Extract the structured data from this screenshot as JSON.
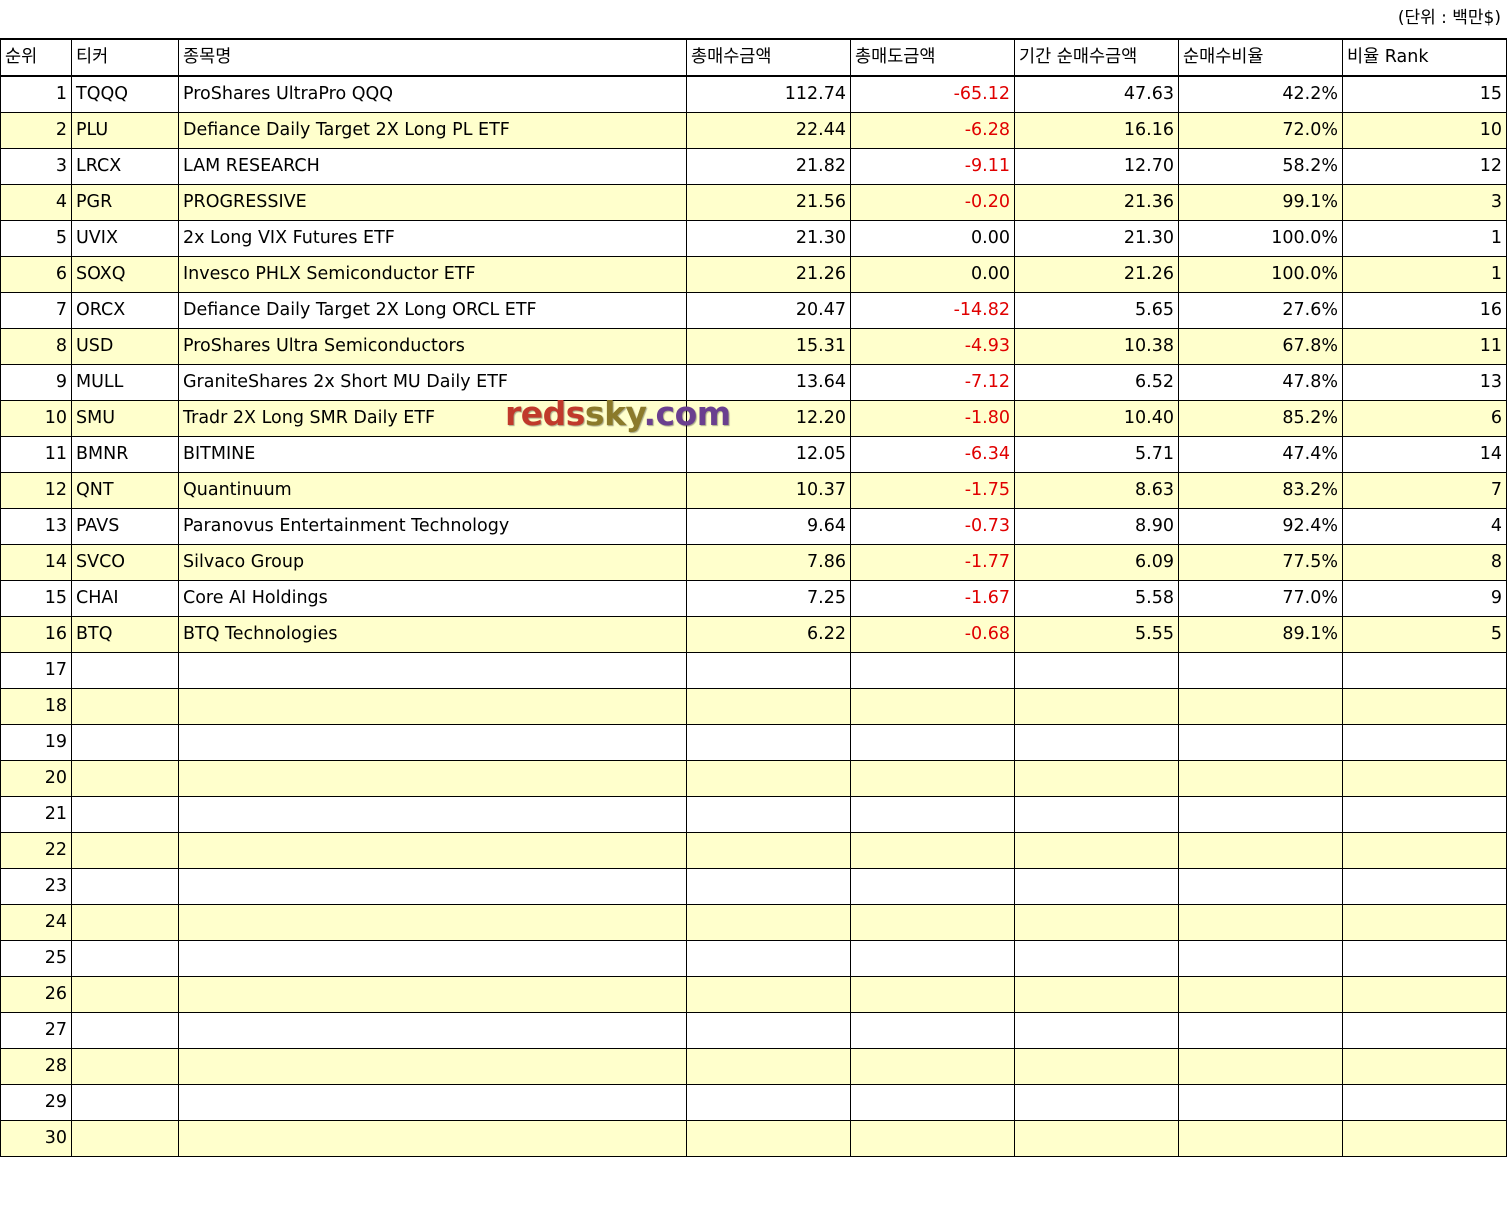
{
  "unit_note": "(단위 : 백만$)",
  "headers": [
    "순위",
    "티커",
    "종목명",
    "총매수금액",
    "총매도금액",
    "기간 순매수금액",
    "순매수비율",
    "비율 Rank"
  ],
  "rows": [
    {
      "rank": "1",
      "ticker": "TQQQ",
      "name": "ProShares UltraPro QQQ",
      "buy": "112.74",
      "sell": "-65.12",
      "net": "47.63",
      "ratio": "42.2%",
      "ratio_rank": "15"
    },
    {
      "rank": "2",
      "ticker": "PLU",
      "name": "Defiance Daily Target 2X Long PL ETF",
      "buy": "22.44",
      "sell": "-6.28",
      "net": "16.16",
      "ratio": "72.0%",
      "ratio_rank": "10"
    },
    {
      "rank": "3",
      "ticker": "LRCX",
      "name": "LAM RESEARCH",
      "buy": "21.82",
      "sell": "-9.11",
      "net": "12.70",
      "ratio": "58.2%",
      "ratio_rank": "12"
    },
    {
      "rank": "4",
      "ticker": "PGR",
      "name": "PROGRESSIVE",
      "buy": "21.56",
      "sell": "-0.20",
      "net": "21.36",
      "ratio": "99.1%",
      "ratio_rank": "3"
    },
    {
      "rank": "5",
      "ticker": "UVIX",
      "name": "2x Long VIX Futures ETF",
      "buy": "21.30",
      "sell": "0.00",
      "net": "21.30",
      "ratio": "100.0%",
      "ratio_rank": "1"
    },
    {
      "rank": "6",
      "ticker": "SOXQ",
      "name": "Invesco PHLX Semiconductor ETF",
      "buy": "21.26",
      "sell": "0.00",
      "net": "21.26",
      "ratio": "100.0%",
      "ratio_rank": "1"
    },
    {
      "rank": "7",
      "ticker": "ORCX",
      "name": "Defiance Daily Target 2X Long ORCL ETF",
      "buy": "20.47",
      "sell": "-14.82",
      "net": "5.65",
      "ratio": "27.6%",
      "ratio_rank": "16"
    },
    {
      "rank": "8",
      "ticker": "USD",
      "name": "ProShares Ultra Semiconductors",
      "buy": "15.31",
      "sell": "-4.93",
      "net": "10.38",
      "ratio": "67.8%",
      "ratio_rank": "11"
    },
    {
      "rank": "9",
      "ticker": "MULL",
      "name": "GraniteShares 2x Short MU Daily ETF",
      "buy": "13.64",
      "sell": "-7.12",
      "net": "6.52",
      "ratio": "47.8%",
      "ratio_rank": "13"
    },
    {
      "rank": "10",
      "ticker": "SMU",
      "name": "Tradr 2X Long SMR Daily ETF",
      "buy": "12.20",
      "sell": "-1.80",
      "net": "10.40",
      "ratio": "85.2%",
      "ratio_rank": "6"
    },
    {
      "rank": "11",
      "ticker": "BMNR",
      "name": "BITMINE",
      "buy": "12.05",
      "sell": "-6.34",
      "net": "5.71",
      "ratio": "47.4%",
      "ratio_rank": "14"
    },
    {
      "rank": "12",
      "ticker": "QNT",
      "name": "Quantinuum",
      "buy": "10.37",
      "sell": "-1.75",
      "net": "8.63",
      "ratio": "83.2%",
      "ratio_rank": "7"
    },
    {
      "rank": "13",
      "ticker": "PAVS",
      "name": "Paranovus Entertainment Technology",
      "buy": "9.64",
      "sell": "-0.73",
      "net": "8.90",
      "ratio": "92.4%",
      "ratio_rank": "4"
    },
    {
      "rank": "14",
      "ticker": "SVCO",
      "name": "Silvaco Group",
      "buy": "7.86",
      "sell": "-1.77",
      "net": "6.09",
      "ratio": "77.5%",
      "ratio_rank": "8"
    },
    {
      "rank": "15",
      "ticker": "CHAI",
      "name": "Core AI Holdings",
      "buy": "7.25",
      "sell": "-1.67",
      "net": "5.58",
      "ratio": "77.0%",
      "ratio_rank": "9"
    },
    {
      "rank": "16",
      "ticker": "BTQ",
      "name": "BTQ Technologies",
      "buy": "6.22",
      "sell": "-0.68",
      "net": "5.55",
      "ratio": "89.1%",
      "ratio_rank": "5"
    },
    {
      "rank": "17",
      "ticker": "",
      "name": "",
      "buy": "",
      "sell": "",
      "net": "",
      "ratio": "",
      "ratio_rank": ""
    },
    {
      "rank": "18",
      "ticker": "",
      "name": "",
      "buy": "",
      "sell": "",
      "net": "",
      "ratio": "",
      "ratio_rank": ""
    },
    {
      "rank": "19",
      "ticker": "",
      "name": "",
      "buy": "",
      "sell": "",
      "net": "",
      "ratio": "",
      "ratio_rank": ""
    },
    {
      "rank": "20",
      "ticker": "",
      "name": "",
      "buy": "",
      "sell": "",
      "net": "",
      "ratio": "",
      "ratio_rank": ""
    },
    {
      "rank": "21",
      "ticker": "",
      "name": "",
      "buy": "",
      "sell": "",
      "net": "",
      "ratio": "",
      "ratio_rank": ""
    },
    {
      "rank": "22",
      "ticker": "",
      "name": "",
      "buy": "",
      "sell": "",
      "net": "",
      "ratio": "",
      "ratio_rank": ""
    },
    {
      "rank": "23",
      "ticker": "",
      "name": "",
      "buy": "",
      "sell": "",
      "net": "",
      "ratio": "",
      "ratio_rank": ""
    },
    {
      "rank": "24",
      "ticker": "",
      "name": "",
      "buy": "",
      "sell": "",
      "net": "",
      "ratio": "",
      "ratio_rank": ""
    },
    {
      "rank": "25",
      "ticker": "",
      "name": "",
      "buy": "",
      "sell": "",
      "net": "",
      "ratio": "",
      "ratio_rank": ""
    },
    {
      "rank": "26",
      "ticker": "",
      "name": "",
      "buy": "",
      "sell": "",
      "net": "",
      "ratio": "",
      "ratio_rank": ""
    },
    {
      "rank": "27",
      "ticker": "",
      "name": "",
      "buy": "",
      "sell": "",
      "net": "",
      "ratio": "",
      "ratio_rank": ""
    },
    {
      "rank": "28",
      "ticker": "",
      "name": "",
      "buy": "",
      "sell": "",
      "net": "",
      "ratio": "",
      "ratio_rank": ""
    },
    {
      "rank": "29",
      "ticker": "",
      "name": "",
      "buy": "",
      "sell": "",
      "net": "",
      "ratio": "",
      "ratio_rank": ""
    },
    {
      "rank": "30",
      "ticker": "",
      "name": "",
      "buy": "",
      "sell": "",
      "net": "",
      "ratio": "",
      "ratio_rank": ""
    }
  ],
  "watermark": {
    "part1": "reds",
    "part2": "sky",
    "part3": ".com"
  },
  "colors": {
    "negative": "#e00000",
    "stripe": "#ffffcc",
    "border": "#000000"
  }
}
